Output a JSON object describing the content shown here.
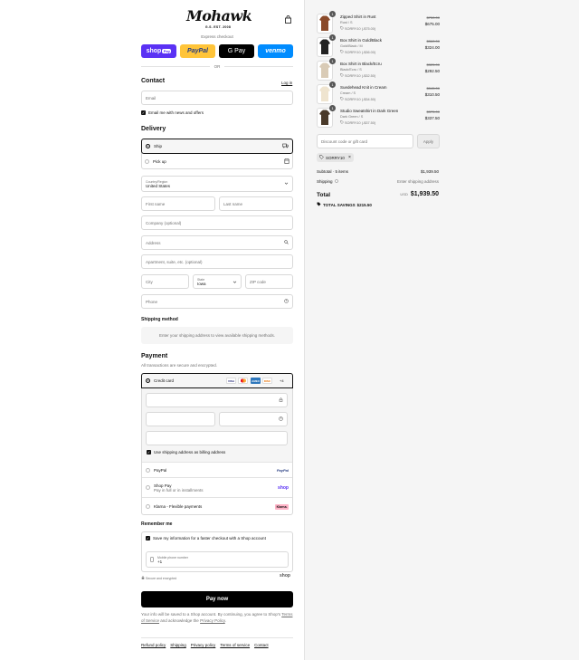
{
  "store": {
    "name": "Mohawk",
    "tagline": "G.S. EST. 2008"
  },
  "express": {
    "title": "Express checkout",
    "or": "OR",
    "buttons": {
      "shop_pay": "shop",
      "shop_pay_badge": "Pay",
      "paypal": "PayPal",
      "gpay": "G Pay",
      "venmo": "venmo"
    }
  },
  "contact": {
    "title": "Contact",
    "login": "Log in",
    "email_placeholder": "Email",
    "news_label": "Email me with news and offers"
  },
  "delivery": {
    "title": "Delivery",
    "options": [
      {
        "label": "Ship"
      },
      {
        "label": "Pick up"
      }
    ],
    "country_label": "Country/Region",
    "country_value": "United States",
    "first_name": "First name",
    "last_name": "Last name",
    "company": "Company (optional)",
    "address": "Address",
    "apartment": "Apartment, suite, etc. (optional)",
    "city": "City",
    "state_label": "State",
    "state_value": "Iowa",
    "zip": "ZIP code",
    "phone": "Phone"
  },
  "shipping_method": {
    "title": "Shipping method",
    "notice": "Enter your shipping address to view available shipping methods."
  },
  "payment": {
    "title": "Payment",
    "subtitle": "All transactions are secure and encrypted.",
    "credit_card": "Credit card",
    "card_brands": [
      "VISA",
      "MC",
      "AMEX",
      "DISC"
    ],
    "more_brands": "+4",
    "billing_label": "Use shipping address as billing address",
    "paypal": "PayPal",
    "paypal_logo": "PayPal",
    "shop_pay": "Shop Pay",
    "shop_pay_sub": "Pay in full or in installments",
    "shop_logo": "shop",
    "klarna": "Klarna - Flexible payments",
    "klarna_logo": "Klarna."
  },
  "remember": {
    "title": "Remember me",
    "save_label": "Save my information for a faster checkout with a Shop account",
    "phone_label": "Mobile phone number",
    "phone_value": "+1",
    "secure": "Secure and encrypted",
    "shop_logo": "shop"
  },
  "pay_button": "Pay now",
  "disclaimer": {
    "text1": "Your info will be saved to a Shop account. By continuing, you agree to Shop's",
    "terms": "Terms of Service",
    "text2": "and acknowledge the",
    "privacy": "Privacy Policy",
    "text3": "."
  },
  "footer": {
    "links": [
      "Refund policy",
      "Shipping",
      "Privacy policy",
      "Terms of service",
      "Contact"
    ]
  },
  "cart": {
    "items": [
      {
        "name": "Zipped Shirt in Rust",
        "variant": "Rust / S",
        "discount": "SORRY10 (-$75.00)",
        "original": "$750.00",
        "price": "$675.00",
        "qty": "1",
        "color": "#8a4a2a"
      },
      {
        "name": "Box Shirt in Gold/Black",
        "variant": "Gold/Black / M",
        "discount": "SORRY10 (-$36.00)",
        "original": "$360.00",
        "price": "$324.00",
        "qty": "1",
        "color": "#222222"
      },
      {
        "name": "Box Shirt in Black/Ecru",
        "variant": "Black/Ecru / S",
        "discount": "SORRY10 (-$32.50)",
        "original": "$325.00",
        "price": "$292.50",
        "qty": "1",
        "color": "#d9cbb6"
      },
      {
        "name": "Suedehead Knit in Cream",
        "variant": "Cream / S",
        "discount": "SORRY10 (-$34.50)",
        "original": "$345.00",
        "price": "$310.50",
        "qty": "1",
        "color": "#efe4cf"
      },
      {
        "name": "Studio Sweatshirt in Dark Green",
        "variant": "Dark Green / S",
        "discount": "SORRY10 (-$37.50)",
        "original": "$375.00",
        "price": "$337.50",
        "qty": "1",
        "color": "#4a3a2a"
      }
    ],
    "discount_placeholder": "Discount code or gift card",
    "apply": "Apply",
    "applied_code": "SORRY10",
    "subtotal_label": "Subtotal · 5 items",
    "subtotal": "$1,939.50",
    "shipping_label": "Shipping",
    "shipping_value": "Enter shipping address",
    "total_label": "Total",
    "currency": "USD",
    "total": "$1,939.50",
    "savings_label": "TOTAL SAVINGS",
    "savings": "$215.50"
  },
  "colors": {
    "shop_pay": "#5a31f4",
    "paypal": "#ffc439",
    "venmo": "#008cff",
    "klarna": "#ffb3c7"
  }
}
